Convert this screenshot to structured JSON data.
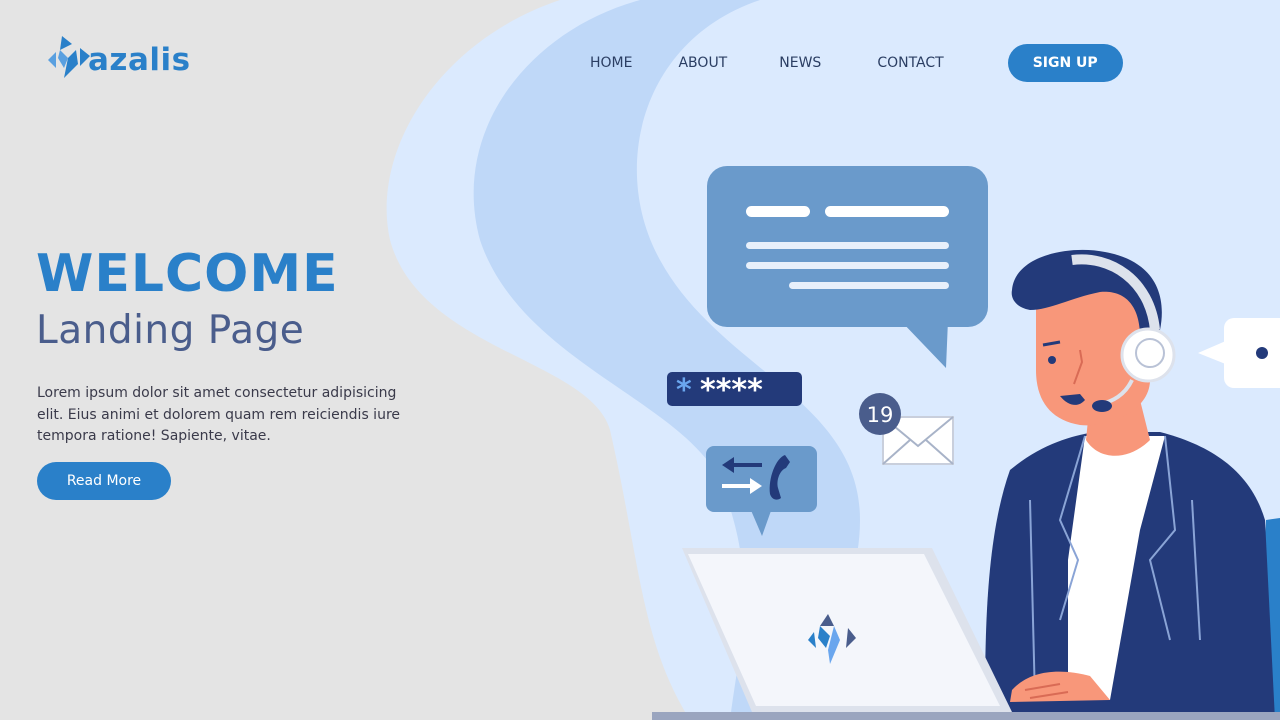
{
  "brand": {
    "name": "azalis",
    "logo_icon": "zigzag-logo-icon"
  },
  "nav": {
    "items": [
      {
        "label": "HOME"
      },
      {
        "label": "ABOUT"
      },
      {
        "label": "NEWS"
      },
      {
        "label": "CONTACT"
      }
    ],
    "signup_label": "SIGN UP"
  },
  "hero": {
    "title": "WELCOME",
    "subtitle": "Landing Page",
    "body": "Lorem ipsum dolor sit amet consectetur adipisicing elit. Eius animi et dolorem quam rem reiciendis iure tempora ratione! Sapiente, vitae.",
    "cta_label": "Read More"
  },
  "illustration": {
    "password_mask": "*****",
    "notification_count": "19",
    "icons": [
      "chat-bubble-icon",
      "password-field-icon",
      "envelope-icon",
      "phone-transfer-icon",
      "laptop-icon",
      "support-agent-figure"
    ]
  },
  "colors": {
    "accent": "#2a80c9",
    "navy": "#233a7a",
    "page_bg": "#e4e4e4",
    "light_blue": "#dbeafe"
  }
}
